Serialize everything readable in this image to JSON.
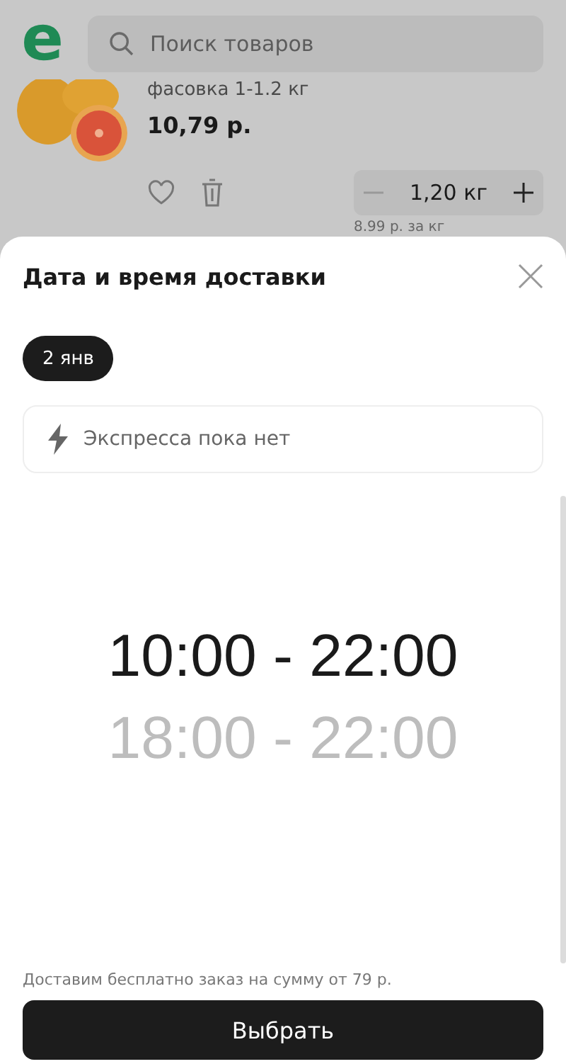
{
  "header": {
    "logo": "e",
    "search": {
      "placeholder": "Поиск товаров"
    }
  },
  "product": {
    "kind": "picture",
    "pack": "фасовка 1-1.2 кг",
    "price": "10,79 р.",
    "favorite": false,
    "quantity": "1,20 кг",
    "unit_price": "8.99 р. за кг"
  },
  "sheet": {
    "title": "Дата и время доставки",
    "dates": [
      {
        "label": "2 янв",
        "selected": true
      }
    ],
    "express": "Экспресса пока нет",
    "time_slots": [
      {
        "label": "10:00 - 22:00",
        "selected": true
      },
      {
        "label": "18:00 - 22:00",
        "selected": false
      }
    ],
    "note": "Доставим бесплатно заказ на сумму от 79 р.",
    "button": "Выбрать"
  }
}
